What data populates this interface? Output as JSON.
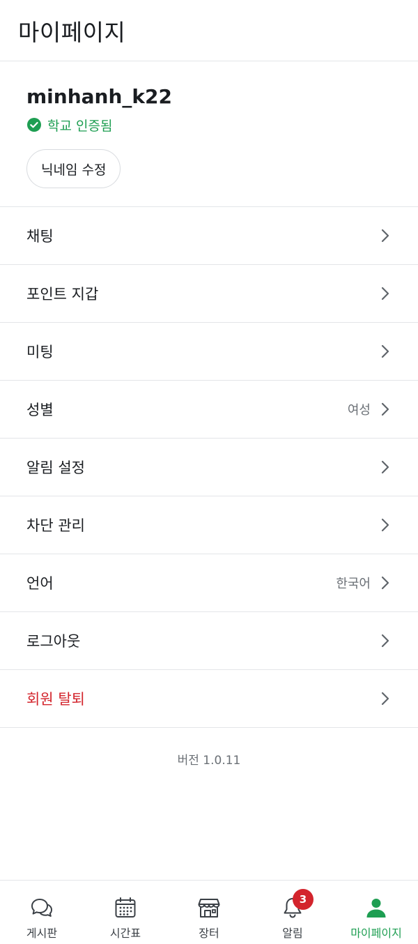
{
  "header": {
    "title": "마이페이지"
  },
  "profile": {
    "username": "minhanh_k22",
    "verified_text": "학교 인증됨",
    "edit_nickname_label": "닉네임 수정"
  },
  "menu": [
    {
      "label": "채팅",
      "value": ""
    },
    {
      "label": "포인트 지갑",
      "value": ""
    },
    {
      "label": "미팅",
      "value": ""
    },
    {
      "label": "성별",
      "value": "여성"
    },
    {
      "label": "알림 설정",
      "value": ""
    },
    {
      "label": "차단 관리",
      "value": ""
    },
    {
      "label": "언어",
      "value": "한국어"
    },
    {
      "label": "로그아웃",
      "value": ""
    },
    {
      "label": "회원 탈퇴",
      "value": ""
    }
  ],
  "version": "버전 1.0.11",
  "tabbar": {
    "items": [
      {
        "label": "게시판",
        "icon": "chat-bubbles-icon"
      },
      {
        "label": "시간표",
        "icon": "calendar-icon"
      },
      {
        "label": "장터",
        "icon": "store-icon"
      },
      {
        "label": "알림",
        "icon": "bell-icon",
        "badge": "3"
      },
      {
        "label": "마이페이지",
        "icon": "person-icon",
        "active": true
      }
    ]
  },
  "colors": {
    "accent": "#1e9e52",
    "danger": "#d3242c",
    "divider": "#e3e5e8",
    "muted": "#6b7076"
  }
}
